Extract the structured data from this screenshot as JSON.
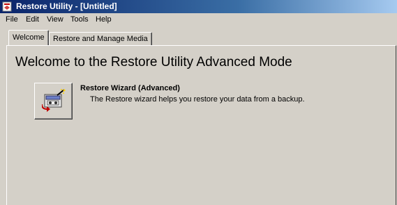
{
  "window": {
    "title": "Restore Utility - [Untitled]",
    "icon": "restore-app-icon"
  },
  "menu": {
    "items": [
      "File",
      "Edit",
      "View",
      "Tools",
      "Help"
    ]
  },
  "tabs": [
    {
      "label": "Welcome",
      "active": true
    },
    {
      "label": "Restore and Manage Media",
      "active": false
    }
  ],
  "welcome": {
    "heading": "Welcome to the Restore Utility Advanced Mode",
    "wizard": {
      "title": "Restore Wizard (Advanced)",
      "description": "The Restore wizard helps you restore your data from a backup.",
      "icon": "restore-wizard-icon"
    }
  },
  "colors": {
    "face": "#d4d0c8",
    "titlebar_start": "#0a246a",
    "titlebar_end": "#a6caf0"
  }
}
